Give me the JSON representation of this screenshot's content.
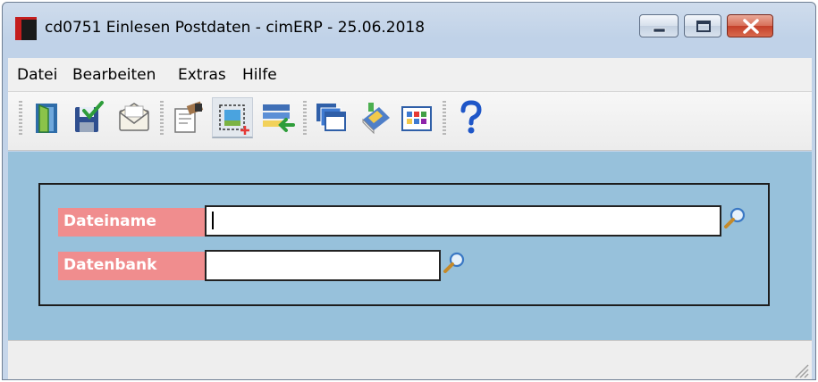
{
  "window": {
    "title": "cd0751 Einlesen Postdaten - cimERP - 25.06.2018",
    "controls": {
      "minimize": "minimize-icon",
      "maximize": "maximize-icon",
      "close": "close-icon"
    }
  },
  "menu": {
    "items": [
      {
        "label": "Datei"
      },
      {
        "label": "Bearbeiten"
      },
      {
        "label": "Extras"
      },
      {
        "label": "Hilfe"
      }
    ]
  },
  "toolbar": {
    "buttons": [
      {
        "icon": "exit-door-icon"
      },
      {
        "icon": "save-check-icon"
      },
      {
        "icon": "mail-envelope-icon"
      },
      {
        "icon": "edit-document-icon"
      },
      {
        "icon": "new-record-icon",
        "active": true
      },
      {
        "icon": "import-list-icon"
      },
      {
        "icon": "windows-stack-icon"
      },
      {
        "icon": "book-icon"
      },
      {
        "icon": "calendar-grid-icon"
      },
      {
        "icon": "help-icon"
      }
    ]
  },
  "form": {
    "fields": [
      {
        "label": "Dateiname",
        "value": ""
      },
      {
        "label": "Datenbank",
        "value": ""
      }
    ]
  },
  "colors": {
    "client_bg": "#97c1db",
    "label_bg": "#f08d8e",
    "label_text": "#ffffff"
  }
}
